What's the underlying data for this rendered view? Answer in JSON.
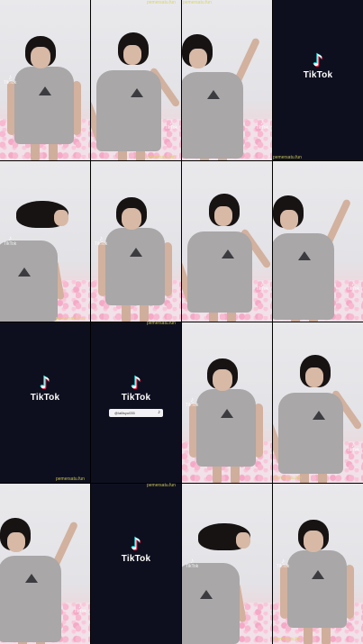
{
  "watermark": "pemersatu.fun",
  "tiktok": {
    "wordmark": "TikTok",
    "note_glyph": "♪"
  },
  "handle_bar": {
    "text": "@lalilsyu035",
    "icon": "tiktok-icon"
  },
  "cells": [
    {
      "kind": "frame",
      "pose": "standing",
      "tt": "left"
    },
    {
      "kind": "frame",
      "pose": "leaning",
      "tt": "right"
    },
    {
      "kind": "frame",
      "pose": "arm-up",
      "tt": "right"
    },
    {
      "kind": "dark",
      "logo": true
    },
    {
      "kind": "frame",
      "pose": "hair-flip",
      "tt": "left"
    },
    {
      "kind": "frame",
      "pose": "standing",
      "tt": "left"
    },
    {
      "kind": "frame",
      "pose": "leaning",
      "tt": "right"
    },
    {
      "kind": "frame",
      "pose": "arm-up",
      "tt": "right"
    },
    {
      "kind": "dark",
      "logo": true
    },
    {
      "kind": "dark",
      "logo": true,
      "handle": true
    },
    {
      "kind": "frame",
      "pose": "standing",
      "tt": "left"
    },
    {
      "kind": "frame",
      "pose": "leaning",
      "tt": "right"
    },
    {
      "kind": "frame",
      "pose": "arm-up",
      "tt": "right"
    },
    {
      "kind": "dark",
      "logo": true
    },
    {
      "kind": "frame",
      "pose": "hair-flip",
      "tt": "left"
    },
    {
      "kind": "frame",
      "pose": "standing",
      "tt": "left"
    }
  ]
}
